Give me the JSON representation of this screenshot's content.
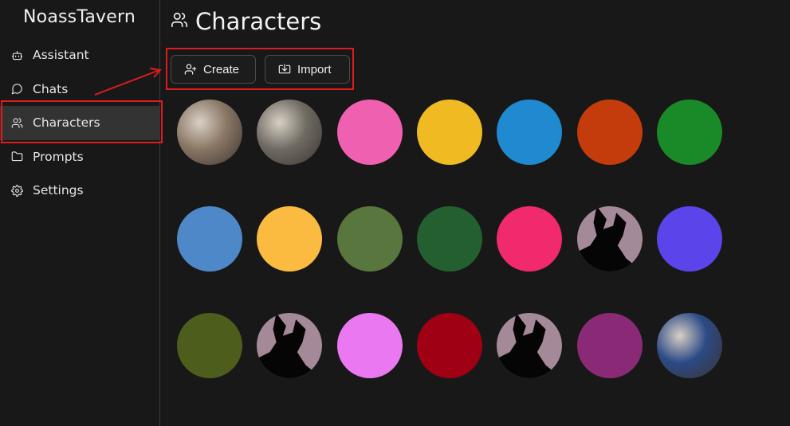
{
  "app": {
    "title": "NoassTavern"
  },
  "sidebar": {
    "items": [
      {
        "label": "Assistant",
        "icon": "bot-icon",
        "active": false
      },
      {
        "label": "Chats",
        "icon": "chat-bubble-icon",
        "active": false
      },
      {
        "label": "Characters",
        "icon": "users-icon",
        "active": true
      },
      {
        "label": "Prompts",
        "icon": "folder-icon",
        "active": false
      },
      {
        "label": "Settings",
        "icon": "gear-icon",
        "active": false
      }
    ]
  },
  "main": {
    "title": "Characters",
    "title_icon": "users-icon",
    "toolbar": {
      "create_label": "Create",
      "import_label": "Import"
    }
  },
  "annotations": {
    "highlight_color": "#e01b1b"
  },
  "characters": [
    {
      "name": "",
      "avatar_type": "image",
      "color": "#8a7766"
    },
    {
      "name": "",
      "avatar_type": "image",
      "color": "#6f6b63"
    },
    {
      "name": "",
      "avatar_type": "solid",
      "color": "#f060b0"
    },
    {
      "name": "",
      "avatar_type": "solid",
      "color": "#efba22"
    },
    {
      "name": "",
      "avatar_type": "solid",
      "color": "#1f8ad0"
    },
    {
      "name": "",
      "avatar_type": "solid",
      "color": "#c43c0c"
    },
    {
      "name": "",
      "avatar_type": "solid",
      "color": "#1a8a28"
    },
    {
      "name": "",
      "avatar_type": "solid",
      "color": "#4e88c9"
    },
    {
      "name": "",
      "avatar_type": "solid",
      "color": "#fbbb40"
    },
    {
      "name": "",
      "avatar_type": "solid",
      "color": "#58763d"
    },
    {
      "name": "",
      "avatar_type": "solid",
      "color": "#24602f"
    },
    {
      "name": "",
      "avatar_type": "solid",
      "color": "#f02a6c"
    },
    {
      "name": "",
      "avatar_type": "silhouette",
      "color": "#a48a98"
    },
    {
      "name": "",
      "avatar_type": "solid",
      "color": "#5b45ea"
    },
    {
      "name": "",
      "avatar_type": "solid",
      "color": "#4d5e1c"
    },
    {
      "name": "",
      "avatar_type": "silhouette",
      "color": "#a48a98"
    },
    {
      "name": "",
      "avatar_type": "solid",
      "color": "#ea78f0"
    },
    {
      "name": "",
      "avatar_type": "solid",
      "color": "#a00014"
    },
    {
      "name": "",
      "avatar_type": "silhouette",
      "color": "#a48a98"
    },
    {
      "name": "",
      "avatar_type": "solid",
      "color": "#8a2a76"
    },
    {
      "name": "",
      "avatar_type": "image",
      "color": "#2c4a86"
    }
  ]
}
